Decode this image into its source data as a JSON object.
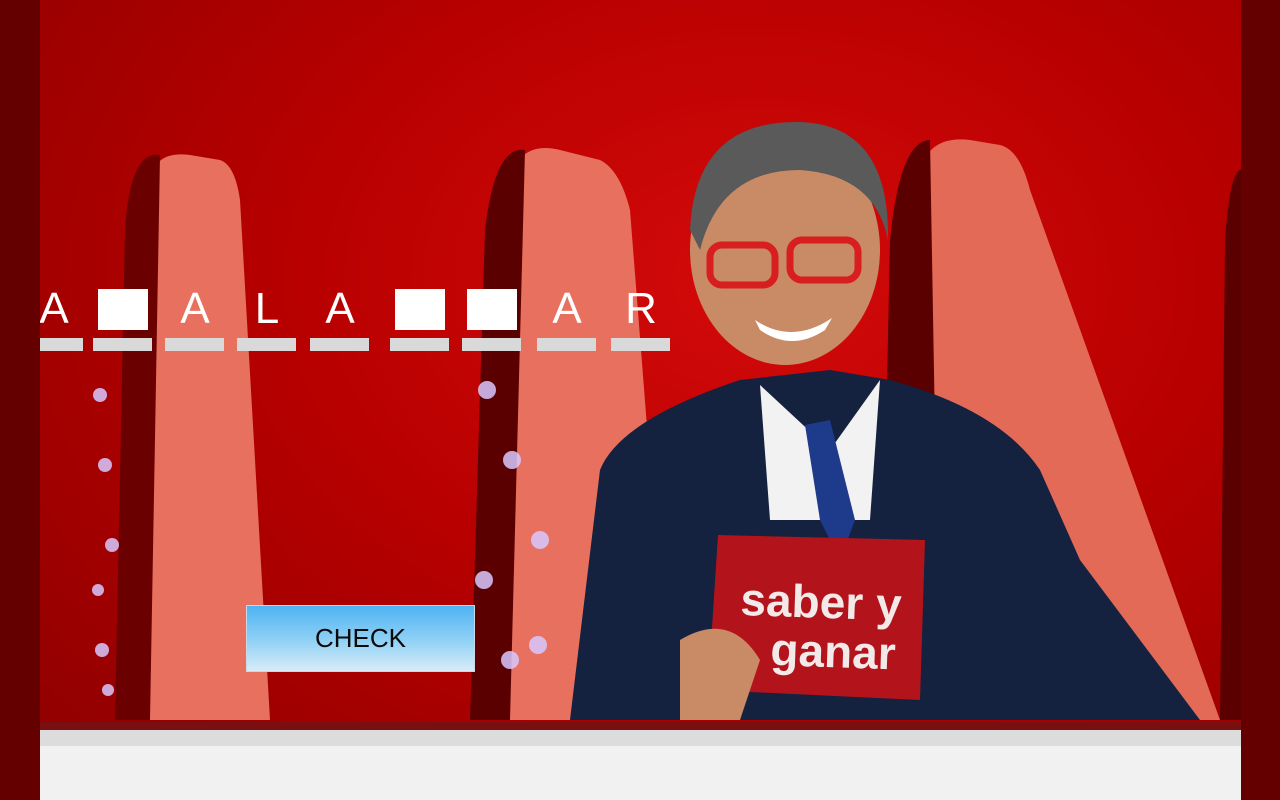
{
  "puzzle": {
    "slots": [
      {
        "letter": "A",
        "blank": false
      },
      {
        "letter": "",
        "blank": true
      },
      {
        "letter": "A",
        "blank": false
      },
      {
        "letter": "L",
        "blank": false
      },
      {
        "letter": "A",
        "blank": false
      },
      {
        "letter": "",
        "blank": true
      },
      {
        "letter": "",
        "blank": true
      },
      {
        "letter": "A",
        "blank": false
      },
      {
        "letter": "R",
        "blank": false
      }
    ]
  },
  "check_button": {
    "label": "CHECK"
  },
  "scene": {
    "card_line1": "saber y",
    "card_line2": "ganar"
  },
  "colors": {
    "background_red": "#b80000",
    "button_top": "#4fb3f2",
    "button_bottom": "#d8ecf7",
    "slot_underline": "#d9d9d9"
  }
}
